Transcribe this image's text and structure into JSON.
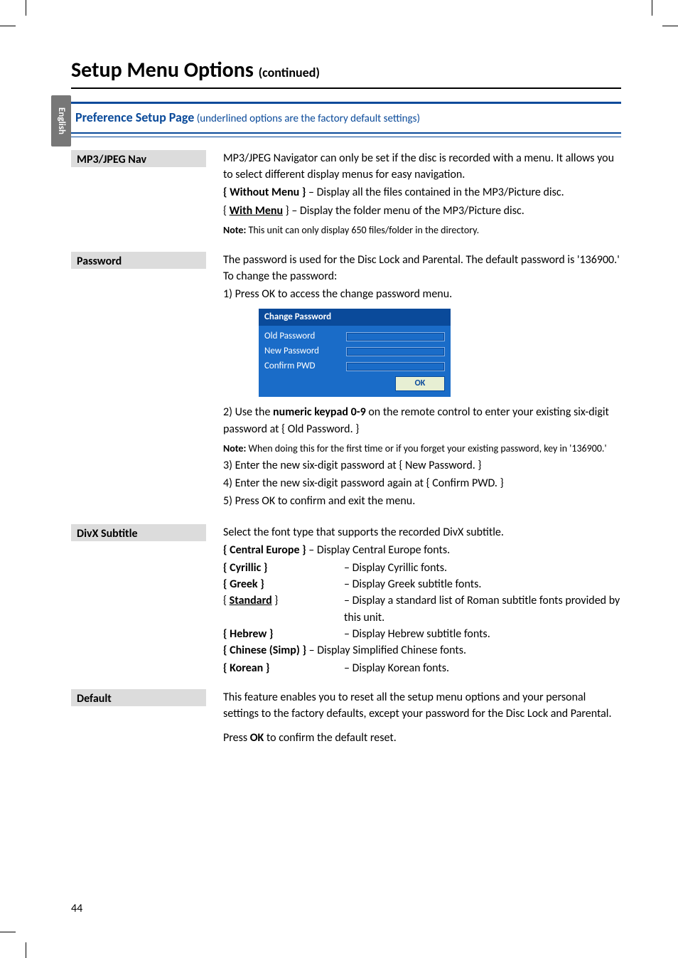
{
  "page": {
    "title": "Setup Menu Options ",
    "title_cont": "(continued)",
    "side_tab": "English",
    "page_number": "44"
  },
  "pref_header": {
    "bold": "Preference Setup Page",
    "rest": " (underlined options are the factory default settings)"
  },
  "mp3": {
    "label": "MP3/JPEG Nav",
    "p1": "MP3/JPEG Navigator can only be set if the disc is recorded with a menu.  It allows you to select different display menus for easy navigation.",
    "opt1_term": "{ Without Menu }",
    "opt1_def": " – Display all the files contained in the MP3/Picture disc.",
    "opt2_term_pre": "{ ",
    "opt2_term_u": "With Menu",
    "opt2_term_post": " }",
    "opt2_def": "  –  Display the folder menu of the MP3/Picture disc.",
    "note_b": "Note:",
    "note_t": "  This unit can only display 650 files/folder in the directory."
  },
  "password": {
    "label": "Password",
    "p1": "The password is used for the Disc Lock and Parental. The default password is '136900.'  To change the password:",
    "s1": "1)  Press OK to access the change password menu.",
    "box_title": "Change Password",
    "box_old": "Old Password",
    "box_new": "New Password",
    "box_conf": "Confirm PWD",
    "box_ok": "OK",
    "s2a": "2)  Use the ",
    "s2b": "numeric keypad 0-9",
    "s2c": " on the remote control to enter your existing six-digit password at { Old Password. }",
    "note2_b": "Note:",
    "note2_t": "  When doing this for the first time or if you forget your existing password, key in '136900.'",
    "s3": "3)  Enter the new six-digit password at { New Password. }",
    "s4": "4)  Enter the new six-digit password again at { Confirm PWD. }",
    "s5": "5)  Press OK to confirm and exit the menu."
  },
  "divx": {
    "label": "DivX Subtitle",
    "p1": "Select the font type that supports the recorded DivX subtitle.",
    "r1t": "{ Central Europe }",
    "r1d": " – Display Central Europe fonts.",
    "r2t": "{ Cyrillic }",
    "r2d": "– Display Cyrillic fonts.",
    "r3t": "{ Greek }",
    "r3d": "– Display Greek subtitle fonts.",
    "r4t_pre": "{ ",
    "r4t_u": "Standard",
    "r4t_post": " }",
    "r4d": "– Display a standard list of Roman subtitle fonts provided by this unit.",
    "r5t": "{ Hebrew }",
    "r5d": "– Display Hebrew subtitle fonts.",
    "r6t": "{ Chinese (Simp) }",
    "r6d": " – Display Simplified Chinese fonts.",
    "r7t": "{ Korean }",
    "r7d": "– Display Korean fonts."
  },
  "def": {
    "label": "Default",
    "p1": "This feature enables you to reset all the setup menu options and your personal settings to the factory defaults, except your password for the Disc Lock and Parental.",
    "p2a": "Press ",
    "p2b": "OK",
    "p2c": " to confirm the default reset."
  }
}
